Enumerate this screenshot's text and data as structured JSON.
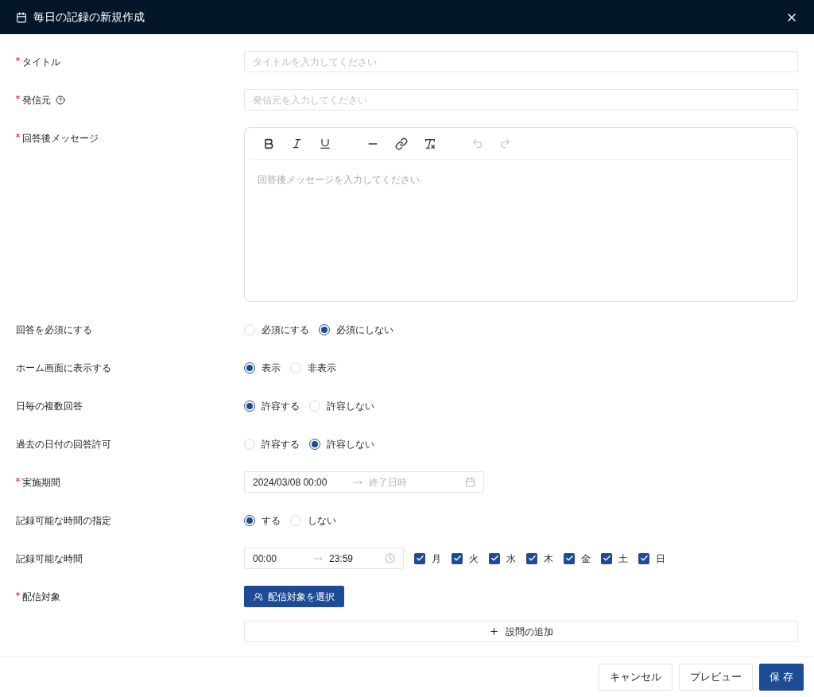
{
  "dialog": {
    "title": "毎日の記録の新規作成"
  },
  "fields": [
    {
      "kind": "text",
      "label": "タイトル",
      "required": true,
      "help": false,
      "placeholder": "タイトルを入力してください"
    },
    {
      "kind": "text",
      "label": "発信元",
      "required": true,
      "help": true,
      "placeholder": "発信元を入力してください"
    },
    {
      "kind": "editor",
      "label": "回答後メッセージ",
      "required": true,
      "placeholder": "回答後メッセージを入力してください"
    },
    {
      "kind": "radio",
      "label": "回答を必須にする",
      "required": false,
      "options": [
        {
          "label": "必須にする",
          "selected": false
        },
        {
          "label": "必須にしない",
          "selected": true
        }
      ]
    },
    {
      "kind": "radio",
      "label": "ホーム画面に表示する",
      "required": false,
      "options": [
        {
          "label": "表示",
          "selected": true
        },
        {
          "label": "非表示",
          "selected": false
        }
      ]
    },
    {
      "kind": "radio",
      "label": "日毎の複数回答",
      "required": false,
      "options": [
        {
          "label": "許容する",
          "selected": true
        },
        {
          "label": "許容しない",
          "selected": false
        }
      ]
    },
    {
      "kind": "radio",
      "label": "過去の日付の回答許可",
      "required": false,
      "options": [
        {
          "label": "許容する",
          "selected": false
        },
        {
          "label": "許容しない",
          "selected": true
        }
      ]
    },
    {
      "kind": "daterange",
      "label": "実施期間",
      "required": true,
      "start": "2024/03/08 00:00",
      "end_placeholder": "終了日時"
    },
    {
      "kind": "radio",
      "label": "記録可能な時間の指定",
      "required": false,
      "options": [
        {
          "label": "する",
          "selected": true
        },
        {
          "label": "しない",
          "selected": false
        }
      ]
    },
    {
      "kind": "timerange",
      "label": "記録可能な時間",
      "required": false,
      "start": "00:00",
      "end": "23:59",
      "days": [
        {
          "label": "月",
          "checked": true
        },
        {
          "label": "火",
          "checked": true
        },
        {
          "label": "水",
          "checked": true
        },
        {
          "label": "木",
          "checked": true
        },
        {
          "label": "金",
          "checked": true
        },
        {
          "label": "土",
          "checked": true
        },
        {
          "label": "日",
          "checked": true
        }
      ]
    },
    {
      "kind": "button",
      "label": "配信対象",
      "required": true,
      "button": "配信対象を選択"
    }
  ],
  "add_question": "設問の追加",
  "footer": {
    "buttons": [
      {
        "label": "キャンセル",
        "primary": false
      },
      {
        "label": "プレビュー",
        "primary": false
      },
      {
        "label": "保 存",
        "primary": true
      }
    ]
  }
}
